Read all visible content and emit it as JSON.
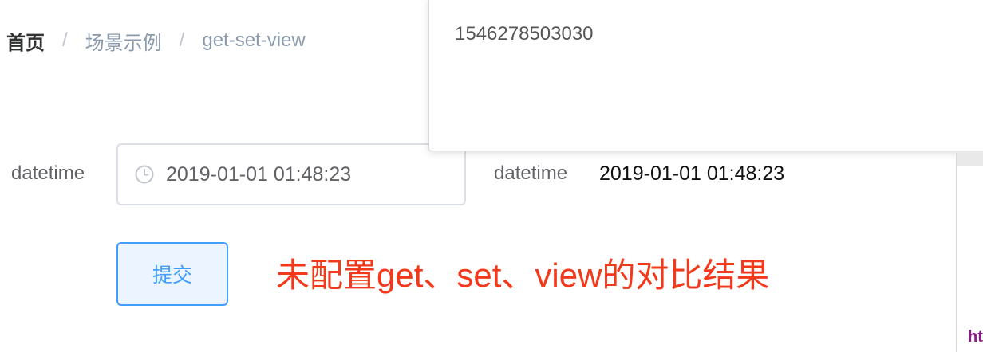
{
  "breadcrumb": {
    "home": "首页",
    "separator": "/",
    "items": [
      "场景示例",
      "get-set-view"
    ]
  },
  "form": {
    "label": "datetime",
    "input_value": "2019-01-01 01:48:23",
    "submit_label": "提交"
  },
  "result": {
    "label": "datetime",
    "value": "2019-01-01 01:48:23"
  },
  "annotation": "未配置get、set、view的对比结果",
  "popup": {
    "text": "1546278503030"
  },
  "right_panel": {
    "snippet": "ht"
  },
  "icons": {
    "input_prefix": "clock-icon"
  },
  "colors": {
    "primary": "#409eff",
    "annotation": "#f2391b",
    "text_main": "#606266"
  }
}
